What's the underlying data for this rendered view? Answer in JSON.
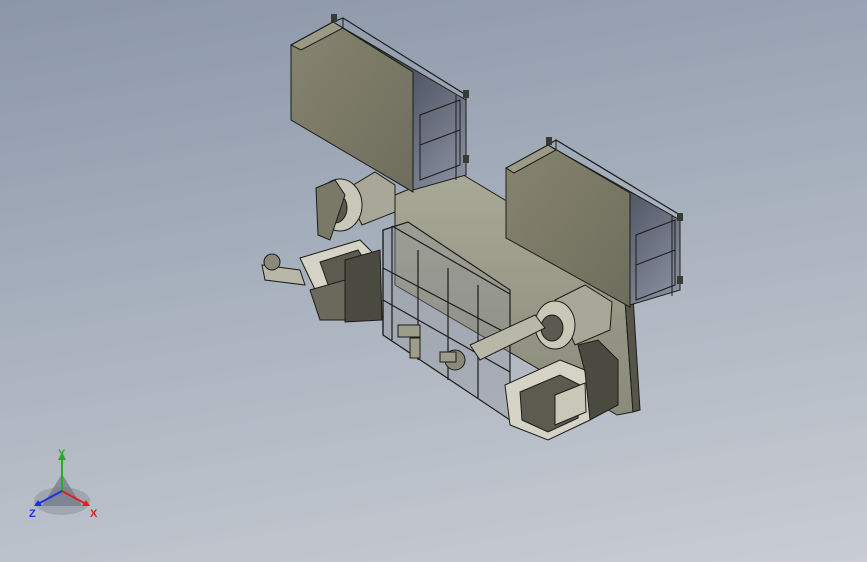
{
  "triad": {
    "x_label": "X",
    "y_label": "Y",
    "z_label": "Z",
    "colors": {
      "x": "#e02020",
      "y": "#20b020",
      "z": "#2030e0"
    }
  },
  "colors": {
    "background_top": "#8b96a8",
    "background_bottom": "#c9cdd3",
    "panel": "#7d7c6c",
    "panel_dark": "#4a4a40",
    "frame": "#9a9a8c",
    "edge": "#1c1c18"
  }
}
